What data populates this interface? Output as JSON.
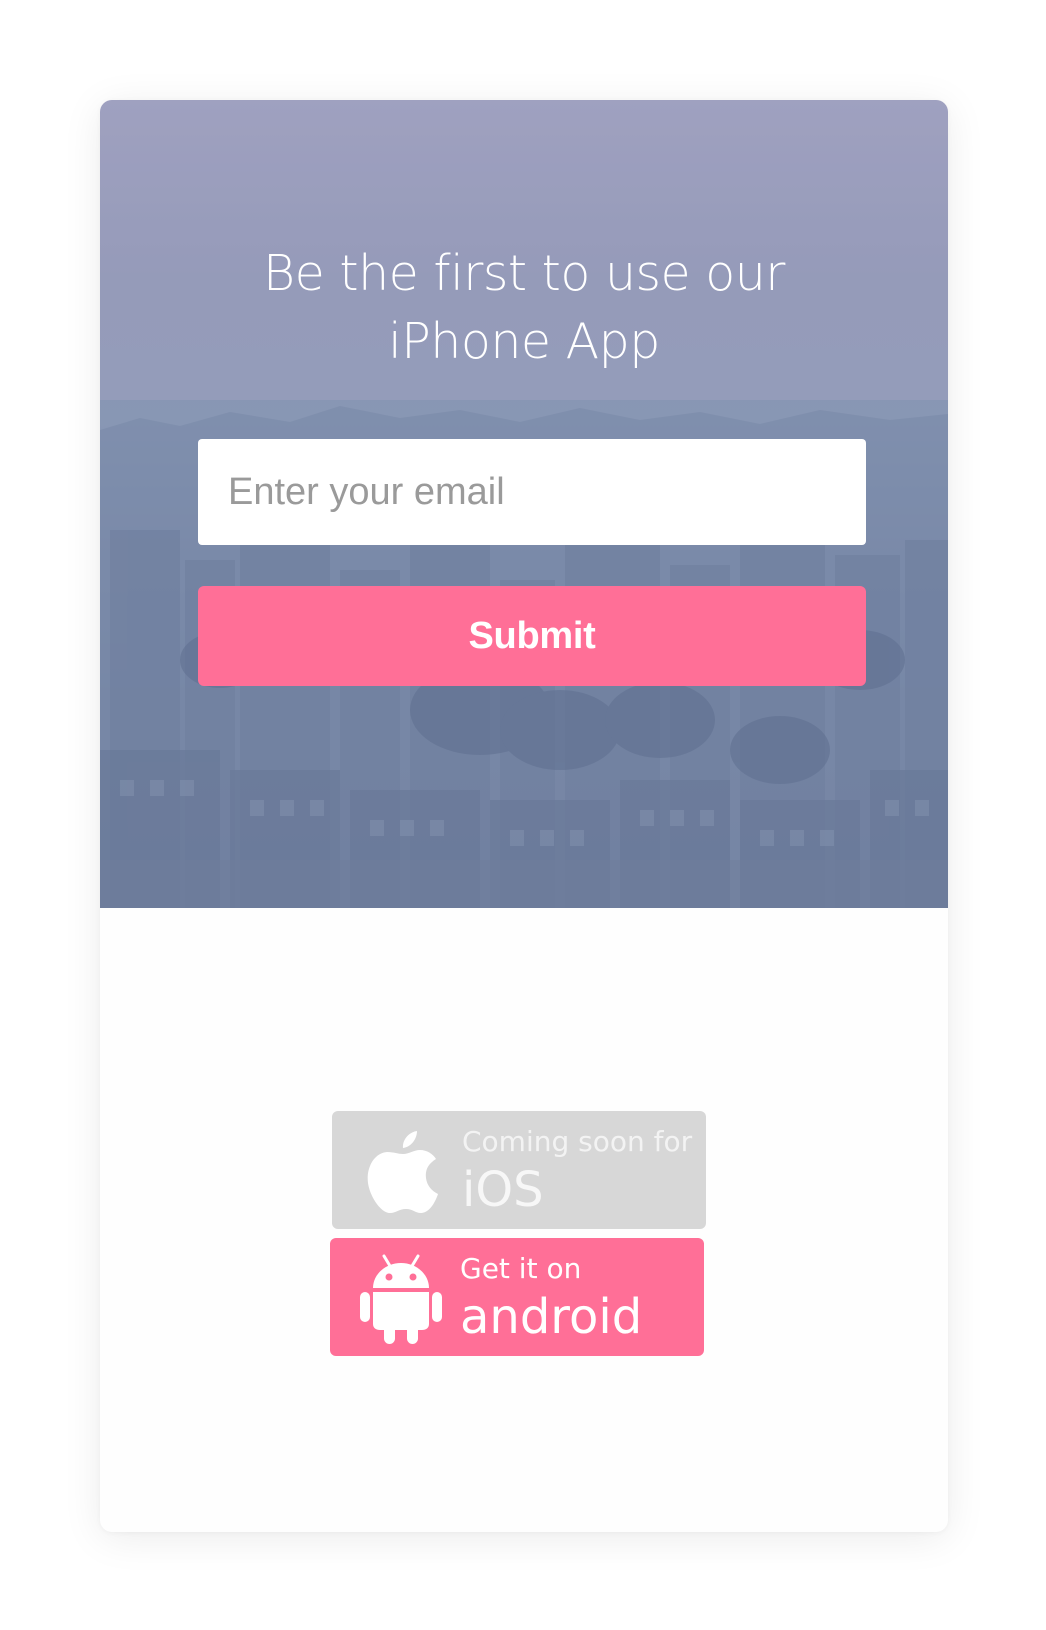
{
  "hero": {
    "headline": "Be the first to use our iPhone App",
    "email_placeholder": "Enter your email",
    "submit_label": "Submit"
  },
  "store_buttons": {
    "ios": {
      "icon": "apple-icon",
      "small_text": "Coming soon for",
      "big_text": "iOS"
    },
    "android": {
      "icon": "android-icon",
      "small_text": "Get it on",
      "big_text": "android"
    }
  },
  "colors": {
    "accent_pink": "#ff6f97",
    "ios_disabled_gray": "#d7d7d7",
    "hero_overlay": "#8e9bb7"
  }
}
